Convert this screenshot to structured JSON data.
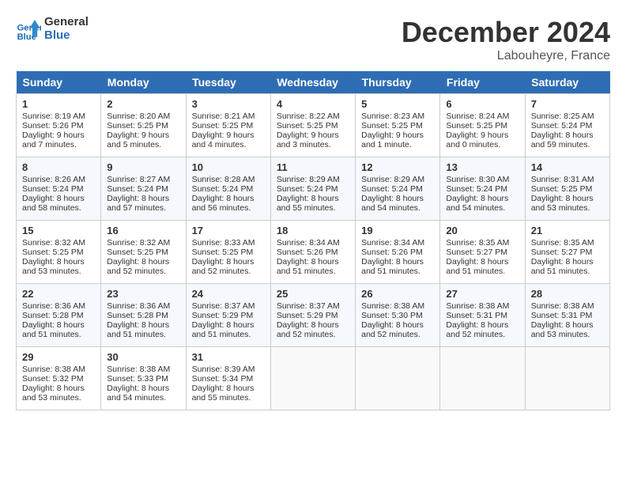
{
  "header": {
    "logo_line1": "General",
    "logo_line2": "Blue",
    "month": "December 2024",
    "location": "Labouheyre, France"
  },
  "weekdays": [
    "Sunday",
    "Monday",
    "Tuesday",
    "Wednesday",
    "Thursday",
    "Friday",
    "Saturday"
  ],
  "weeks": [
    [
      {
        "day": "1",
        "sunrise": "8:19 AM",
        "sunset": "5:26 PM",
        "daylight": "9 hours and 7 minutes."
      },
      {
        "day": "2",
        "sunrise": "8:20 AM",
        "sunset": "5:25 PM",
        "daylight": "9 hours and 5 minutes."
      },
      {
        "day": "3",
        "sunrise": "8:21 AM",
        "sunset": "5:25 PM",
        "daylight": "9 hours and 4 minutes."
      },
      {
        "day": "4",
        "sunrise": "8:22 AM",
        "sunset": "5:25 PM",
        "daylight": "9 hours and 3 minutes."
      },
      {
        "day": "5",
        "sunrise": "8:23 AM",
        "sunset": "5:25 PM",
        "daylight": "9 hours and 1 minute."
      },
      {
        "day": "6",
        "sunrise": "8:24 AM",
        "sunset": "5:25 PM",
        "daylight": "9 hours and 0 minutes."
      },
      {
        "day": "7",
        "sunrise": "8:25 AM",
        "sunset": "5:24 PM",
        "daylight": "8 hours and 59 minutes."
      }
    ],
    [
      {
        "day": "8",
        "sunrise": "8:26 AM",
        "sunset": "5:24 PM",
        "daylight": "8 hours and 58 minutes."
      },
      {
        "day": "9",
        "sunrise": "8:27 AM",
        "sunset": "5:24 PM",
        "daylight": "8 hours and 57 minutes."
      },
      {
        "day": "10",
        "sunrise": "8:28 AM",
        "sunset": "5:24 PM",
        "daylight": "8 hours and 56 minutes."
      },
      {
        "day": "11",
        "sunrise": "8:29 AM",
        "sunset": "5:24 PM",
        "daylight": "8 hours and 55 minutes."
      },
      {
        "day": "12",
        "sunrise": "8:29 AM",
        "sunset": "5:24 PM",
        "daylight": "8 hours and 54 minutes."
      },
      {
        "day": "13",
        "sunrise": "8:30 AM",
        "sunset": "5:24 PM",
        "daylight": "8 hours and 54 minutes."
      },
      {
        "day": "14",
        "sunrise": "8:31 AM",
        "sunset": "5:25 PM",
        "daylight": "8 hours and 53 minutes."
      }
    ],
    [
      {
        "day": "15",
        "sunrise": "8:32 AM",
        "sunset": "5:25 PM",
        "daylight": "8 hours and 53 minutes."
      },
      {
        "day": "16",
        "sunrise": "8:32 AM",
        "sunset": "5:25 PM",
        "daylight": "8 hours and 52 minutes."
      },
      {
        "day": "17",
        "sunrise": "8:33 AM",
        "sunset": "5:25 PM",
        "daylight": "8 hours and 52 minutes."
      },
      {
        "day": "18",
        "sunrise": "8:34 AM",
        "sunset": "5:26 PM",
        "daylight": "8 hours and 51 minutes."
      },
      {
        "day": "19",
        "sunrise": "8:34 AM",
        "sunset": "5:26 PM",
        "daylight": "8 hours and 51 minutes."
      },
      {
        "day": "20",
        "sunrise": "8:35 AM",
        "sunset": "5:27 PM",
        "daylight": "8 hours and 51 minutes."
      },
      {
        "day": "21",
        "sunrise": "8:35 AM",
        "sunset": "5:27 PM",
        "daylight": "8 hours and 51 minutes."
      }
    ],
    [
      {
        "day": "22",
        "sunrise": "8:36 AM",
        "sunset": "5:28 PM",
        "daylight": "8 hours and 51 minutes."
      },
      {
        "day": "23",
        "sunrise": "8:36 AM",
        "sunset": "5:28 PM",
        "daylight": "8 hours and 51 minutes."
      },
      {
        "day": "24",
        "sunrise": "8:37 AM",
        "sunset": "5:29 PM",
        "daylight": "8 hours and 51 minutes."
      },
      {
        "day": "25",
        "sunrise": "8:37 AM",
        "sunset": "5:29 PM",
        "daylight": "8 hours and 52 minutes."
      },
      {
        "day": "26",
        "sunrise": "8:38 AM",
        "sunset": "5:30 PM",
        "daylight": "8 hours and 52 minutes."
      },
      {
        "day": "27",
        "sunrise": "8:38 AM",
        "sunset": "5:31 PM",
        "daylight": "8 hours and 52 minutes."
      },
      {
        "day": "28",
        "sunrise": "8:38 AM",
        "sunset": "5:31 PM",
        "daylight": "8 hours and 53 minutes."
      }
    ],
    [
      {
        "day": "29",
        "sunrise": "8:38 AM",
        "sunset": "5:32 PM",
        "daylight": "8 hours and 53 minutes."
      },
      {
        "day": "30",
        "sunrise": "8:38 AM",
        "sunset": "5:33 PM",
        "daylight": "8 hours and 54 minutes."
      },
      {
        "day": "31",
        "sunrise": "8:39 AM",
        "sunset": "5:34 PM",
        "daylight": "8 hours and 55 minutes."
      },
      null,
      null,
      null,
      null
    ]
  ]
}
